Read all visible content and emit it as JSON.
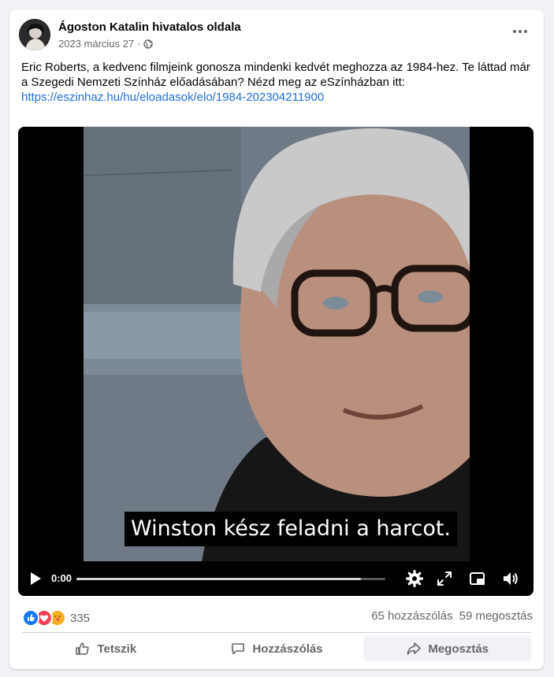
{
  "post": {
    "author": "Ágoston Katalin hivatalos oldala",
    "date": "2023 március 27",
    "separator": "·",
    "text": "Eric Roberts, a kedvenc filmjeink gonosza mindenki kedvét meghozza az 1984-hez. Te láttad már a Szegedi Nemzeti Színház előadásában? Nézd meg az eSzínházban itt:",
    "link": "https://eszinhaz.hu/hu/eloadasok/elo/1984-202304211900"
  },
  "video": {
    "subtitle": "Winston kész feladni a harcot.",
    "time": "0:00",
    "buffered_fraction": 0.92
  },
  "stats": {
    "reaction_count": "335",
    "comments": "65 hozzászólás",
    "shares": "59 megosztás"
  },
  "actions": {
    "like": "Tetszik",
    "comment": "Hozzászólás",
    "share": "Megosztás"
  },
  "colors": {
    "link": "#216fdb",
    "like_reaction": "#1877f2",
    "love_reaction": "#f33e58",
    "care_reaction": "#f7b125",
    "muted_text": "#65676b"
  },
  "icons": [
    "globe-icon",
    "more-icon",
    "play-icon",
    "settings-icon",
    "fullscreen-icon",
    "pip-icon",
    "volume-icon",
    "like-icon",
    "love-icon",
    "care-icon",
    "thumbs-up-icon",
    "comment-icon",
    "share-icon"
  ]
}
